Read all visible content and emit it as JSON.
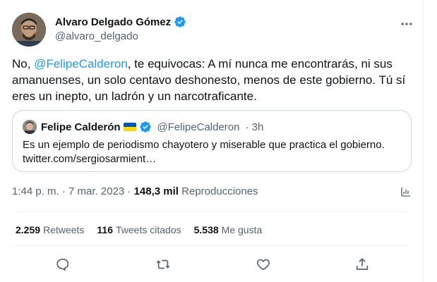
{
  "author": {
    "name": "Alvaro Delgado Gómez",
    "handle": "@alvaro_delgado",
    "verified_icon": "verified-badge-icon",
    "avatar_icon": "avatar"
  },
  "tweet": {
    "prefix": "No, ",
    "mention": "@FelipeCalderon",
    "body": ", te equivocas: A mí nunca me encontrarás, ni sus amanuenses, un solo centavo deshonesto, menos de este gobierno. Tú sí eres un inepto, un ladrón y un narcotraficante."
  },
  "quote": {
    "name": "Felipe Calderón",
    "handle": "@FelipeCalderon",
    "time": "· 3h",
    "text": "Es un ejemplo de periodismo chayotero y miserable que practica el gobierno. twitter.com/sergiosarmient…",
    "flag_colors": [
      "#0057b7",
      "#ffd700"
    ]
  },
  "meta": {
    "time": "1:44 p. m. · 7 mar. 2023 ·",
    "views_count": "148,3 mil",
    "views_label": "Reproducciones"
  },
  "stats": {
    "retweets_count": "2.259",
    "retweets_label": "Retweets",
    "quotes_count": "116",
    "quotes_label": "Tweets citados",
    "likes_count": "5.538",
    "likes_label": "Me gusta"
  },
  "colors": {
    "accent": "#1d9bf0",
    "text": "#0f1419",
    "muted": "#536471",
    "border": "#eff3f4"
  }
}
